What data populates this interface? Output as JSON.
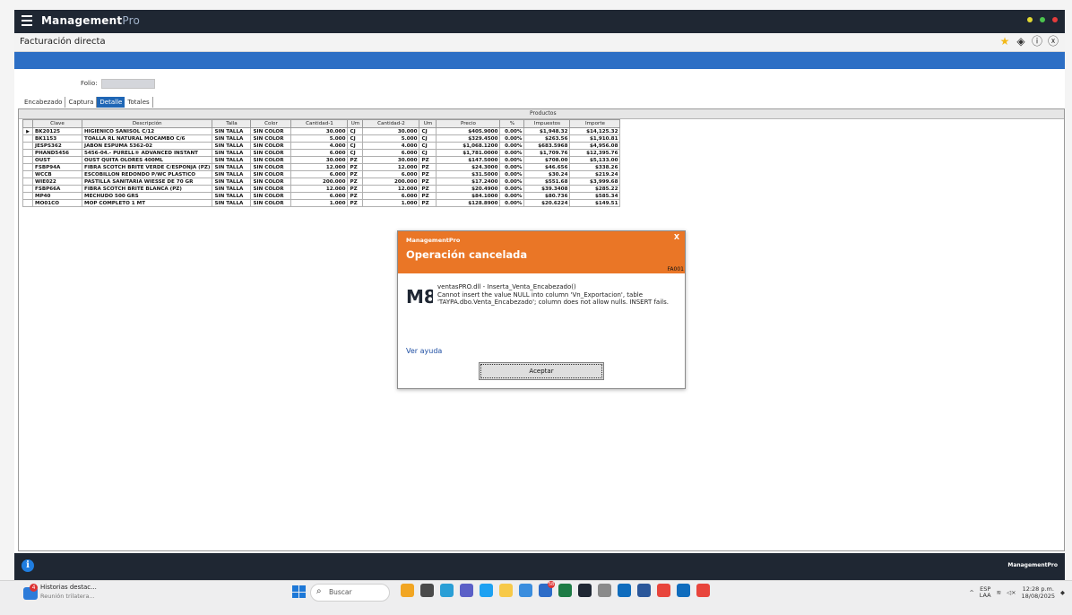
{
  "app": {
    "brand_main": "Management",
    "brand_pro": "Pro",
    "page_title": "Facturación directa"
  },
  "colors": {
    "appbar": "#1f2733",
    "bluebar": "#2d6fc5",
    "accent": "#ea7626",
    "dot1": "#e1d832",
    "dot2": "#4bc34e",
    "dot3": "#e53c3c"
  },
  "form": {
    "folio_label": "Folio:",
    "folio_value": ""
  },
  "tabs": [
    {
      "label": "Encabezado",
      "active": false
    },
    {
      "label": "Captura",
      "active": false
    },
    {
      "label": "Detalle",
      "active": true
    },
    {
      "label": "Totales",
      "active": false
    }
  ],
  "grid": {
    "caption": "Productos",
    "columns": [
      "Clave",
      "Descripción",
      "Talla",
      "Color",
      "Cantidad-1",
      "Um",
      "Cantidad-2",
      "Um",
      "Precio",
      "%",
      "Impuestos",
      "Importe"
    ],
    "rows": [
      [
        "BK20125",
        "HIGIENICO SANISOL C/12",
        "SIN TALLA",
        "SIN COLOR",
        "30.000",
        "CJ",
        "30.000",
        "CJ",
        "$405.9000",
        "0.00%",
        "$1,948.32",
        "$14,125.32"
      ],
      [
        "BK1153",
        "TOALLA RL NATURAL MOCAMBO C/6",
        "SIN TALLA",
        "SIN COLOR",
        "5.000",
        "CJ",
        "5.000",
        "CJ",
        "$329.4500",
        "0.00%",
        "$263.56",
        "$1,910.81"
      ],
      [
        "JESPS362",
        "JABON ESPUMA 5362-02",
        "SIN TALLA",
        "SIN COLOR",
        "4.000",
        "CJ",
        "4.000",
        "CJ",
        "$1,068.1200",
        "0.00%",
        "$683.5968",
        "$4,956.08"
      ],
      [
        "PHAND5456",
        "5456-04.- PURELL® ADVANCED INSTANT",
        "SIN TALLA",
        "SIN COLOR",
        "6.000",
        "CJ",
        "6.000",
        "CJ",
        "$1,781.0000",
        "0.00%",
        "$1,709.76",
        "$12,395.76"
      ],
      [
        "OUST",
        "OUST QUITA OLORES 400ML",
        "SIN TALLA",
        "SIN COLOR",
        "30.000",
        "PZ",
        "30.000",
        "PZ",
        "$147.5000",
        "0.00%",
        "$708.00",
        "$5,133.00"
      ],
      [
        "FSBP94A",
        "FIBRA SCOTCH BRITE VERDE C/ESPONJA (PZ)",
        "SIN TALLA",
        "SIN COLOR",
        "12.000",
        "PZ",
        "12.000",
        "PZ",
        "$24.3000",
        "0.00%",
        "$46.656",
        "$338.26"
      ],
      [
        "WCCB",
        "ESCOBILLON REDONDO P/WC PLASTICO",
        "SIN TALLA",
        "SIN COLOR",
        "6.000",
        "PZ",
        "6.000",
        "PZ",
        "$31.5000",
        "0.00%",
        "$30.24",
        "$219.24"
      ],
      [
        "WIE022",
        "PASTILLA SANITARIA WIESSE DE 70 GR",
        "SIN TALLA",
        "SIN COLOR",
        "200.000",
        "PZ",
        "200.000",
        "PZ",
        "$17.2400",
        "0.00%",
        "$551.68",
        "$3,999.68"
      ],
      [
        "FSBP66A",
        "FIBRA SCOTCH BRITE BLANCA (PZ)",
        "SIN TALLA",
        "SIN COLOR",
        "12.000",
        "PZ",
        "12.000",
        "PZ",
        "$20.4900",
        "0.00%",
        "$39.3408",
        "$285.22"
      ],
      [
        "MP40",
        "MECHUDO 500 GRS",
        "SIN TALLA",
        "SIN COLOR",
        "6.000",
        "PZ",
        "6.000",
        "PZ",
        "$84.1000",
        "0.00%",
        "$80.736",
        "$585.34"
      ],
      [
        "MO01CO",
        "MOP COMPLETO 1 MT",
        "SIN TALLA",
        "SIN COLOR",
        "1.000",
        "PZ",
        "1.000",
        "PZ",
        "$128.8900",
        "0.00%",
        "$20.6224",
        "$149.51"
      ]
    ]
  },
  "dialog": {
    "app_name": "ManagementPro",
    "close": "X",
    "title": "Operación cancelada",
    "code": "FA001",
    "logo_text": "M8",
    "message_line1": "ventasPRO.dll - Inserta_Venta_Encabezado()",
    "message_body": "Cannot insert the value NULL into column 'Vn_Exportacion', table 'TAYPA.dbo.Venta_Encabezado'; column does not allow nulls. INSERT fails.",
    "help_link": "Ver ayuda",
    "accept_button": "Aceptar"
  },
  "footer": {
    "brand": "ManagementPro"
  },
  "taskbar": {
    "news_title": "Historias destac...",
    "news_subtitle": "Reunión trilatera...",
    "news_badge": "4",
    "search_placeholder": "Buscar",
    "app_badge": "58",
    "lang_top": "ESP",
    "lang_bottom": "LAA",
    "time": "12:28 p.m.",
    "date": "18/08/2025",
    "app_icons": [
      "weather",
      "files",
      "browser",
      "teams",
      "chrome",
      "explorer",
      "store",
      "mail",
      "excel",
      "management",
      "app",
      "outlook",
      "word",
      "chrome2",
      "outlook2",
      "chrome3"
    ]
  }
}
